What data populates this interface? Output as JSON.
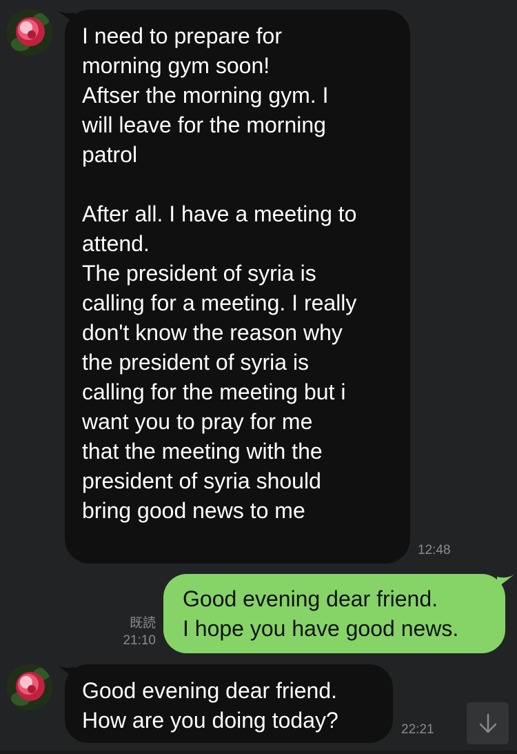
{
  "messages": [
    {
      "direction": "incoming",
      "text": "I need to prepare for\nmorning gym soon!\nAftser the morning gym. I\nwill leave for the morning\npatrol\n\nAfter all. I have a meeting to\nattend.\nThe president of syria is\ncalling for a meeting. I really\ndon't know the reason why\nthe president of syria is\ncalling for the meeting but i\nwant you to pray for me\nthat the meeting with the\npresident of syria should\nbring good news to me",
      "time": "12:48"
    },
    {
      "direction": "outgoing",
      "text": "Good evening dear friend.\nI hope you have good news.",
      "read_label": "既読",
      "time": "21:10"
    },
    {
      "direction": "incoming",
      "text": "Good evening dear friend.\nHow are you doing today?",
      "time": "22:21"
    }
  ],
  "colors": {
    "background": "#222324",
    "incoming_bubble": "#101010",
    "outgoing_bubble": "#86d468",
    "meta_text": "#8a8b8d"
  },
  "icons": {
    "avatar": "rose-avatar",
    "scroll": "arrow-down-icon"
  }
}
